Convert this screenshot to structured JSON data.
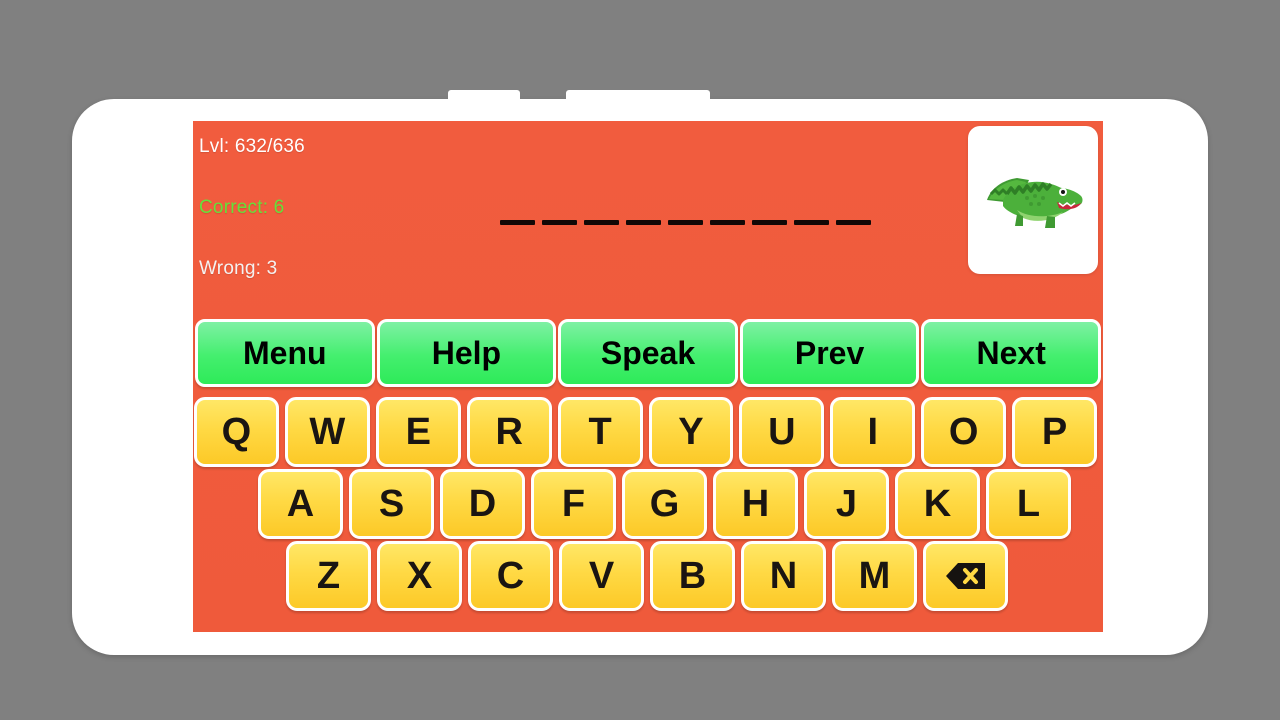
{
  "app": {
    "background_color": "#f05a3c",
    "frame_color": "#ffffff",
    "page_background": "#808080"
  },
  "status": {
    "level_label": "Lvl: 632/636",
    "level_current": 632,
    "level_total": 636,
    "correct_label": "Correct: 6",
    "correct_count": 6,
    "correct_color": "#66e03a",
    "wrong_label": "Wrong: 3",
    "wrong_count": 3,
    "wrong_color": "#f4f2f1"
  },
  "puzzle": {
    "blank_count": 9,
    "blanks": [
      "_",
      "_",
      "_",
      "_",
      "_",
      "_",
      "_",
      "_",
      "_"
    ],
    "revealed_letters": "",
    "image_name": "crocodile-illustration",
    "image_alt": "Crocodile"
  },
  "actions": {
    "buttons": [
      {
        "label": "Menu",
        "name": "menu-button"
      },
      {
        "label": "Help",
        "name": "help-button"
      },
      {
        "label": "Speak",
        "name": "speak-button"
      },
      {
        "label": "Prev",
        "name": "prev-button"
      },
      {
        "label": "Next",
        "name": "next-button"
      }
    ],
    "button_color": "#3ded66",
    "button_text_color": "#000000"
  },
  "keyboard": {
    "key_color": "#ffd944",
    "key_text_color": "#1a1512",
    "rows": [
      {
        "keys": [
          "Q",
          "W",
          "E",
          "R",
          "T",
          "Y",
          "U",
          "I",
          "O",
          "P"
        ]
      },
      {
        "keys": [
          "A",
          "S",
          "D",
          "F",
          "G",
          "H",
          "J",
          "K",
          "L"
        ]
      },
      {
        "keys": [
          "Z",
          "X",
          "C",
          "V",
          "B",
          "N",
          "M"
        ]
      }
    ],
    "backspace": {
      "label": "",
      "icon": "backspace-delete-icon"
    }
  },
  "device": {
    "notch_speaker": "speaker-notch",
    "notch_camera": "camera-notch"
  }
}
